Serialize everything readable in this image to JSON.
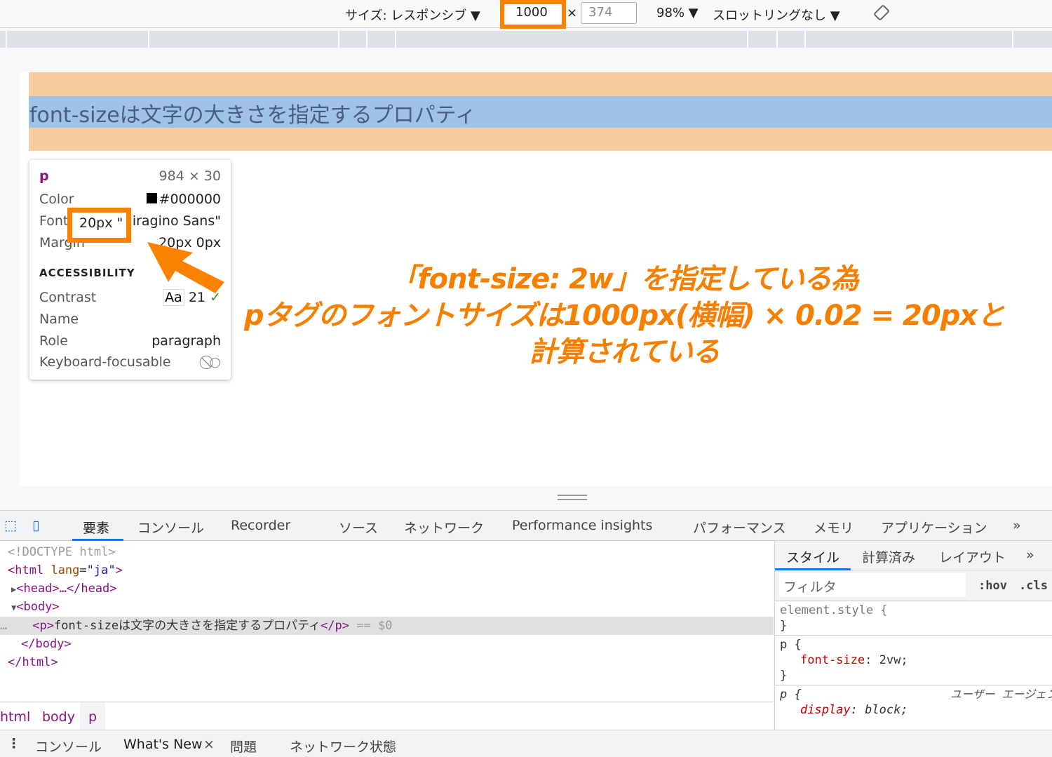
{
  "device_toolbar": {
    "size_label": "サイズ: レスポンシブ ▼",
    "width_value": "1000",
    "times": "×",
    "height_value": "374",
    "zoom": "98% ▼",
    "throttling": "スロットリングなし ▼",
    "rotate_icon": "rotate-icon"
  },
  "page": {
    "paragraph_text": "font-sizeは文字の大きさを指定するプロパティ"
  },
  "tooltip": {
    "tag": "p",
    "size": "984 × 30",
    "color_label": "Color",
    "color_value": "#000000",
    "font_label": "Font",
    "font_value": "20px \"Hiragino Sans\"",
    "margin_label": "Margin",
    "margin_value": "20px 0px",
    "accessibility_heading": "ACCESSIBILITY",
    "contrast_label": "Contrast",
    "contrast_sample": "Aa",
    "contrast_value": "21",
    "name_label": "Name",
    "role_label": "Role",
    "role_value": "paragraph",
    "keyboard_label": "Keyboard-focusable"
  },
  "annotation": {
    "line1": "「font-size: 2w」を指定している為",
    "line2": "pタグのフォントサイズは1000px(横幅) × 0.02 = 20pxと計算されている",
    "highlight_font": "20px \"",
    "color": "#fb8200"
  },
  "devtools": {
    "tabs": [
      "要素",
      "コンソール",
      "Recorder",
      "ソース",
      "ネットワーク",
      "Performance insights",
      "パフォーマンス",
      "メモリ",
      "アプリケーション",
      "»"
    ],
    "dom": {
      "doctype": "<!DOCTYPE html>",
      "html_open": "<html",
      "lang_attr": "lang",
      "lang_val": "\"ja\"",
      "html_close_bracket": ">",
      "head": "<head>…</head>",
      "body_open": "<body>",
      "p_open": "<p>",
      "p_text": "font-sizeは文字の大きさを指定するプロパティ",
      "p_close": "</p>",
      "selected_marker": "== $0",
      "body_close": "</body>",
      "html_close": "</html>",
      "dots": "…"
    },
    "breadcrumbs": [
      "html",
      "body",
      "p"
    ],
    "styles": {
      "tabs": [
        "スタイル",
        "計算済み",
        "レイアウト",
        "»"
      ],
      "filter_placeholder": "フィルタ",
      "hov": ":hov",
      "cls": ".cls",
      "rule1_selector": "element.style {",
      "close_brace": "}",
      "rule2_selector": "p {",
      "rule2_prop": "font-size",
      "rule2_val": "2vw;",
      "rule3_selector": "p {",
      "rule3_origin": "ユーザー エージェント",
      "rule3_prop": "display",
      "rule3_val": "block;"
    },
    "drawer": {
      "tabs": [
        "コンソール",
        "What's New",
        "問題",
        "ネットワーク状態"
      ],
      "close": "×"
    }
  }
}
